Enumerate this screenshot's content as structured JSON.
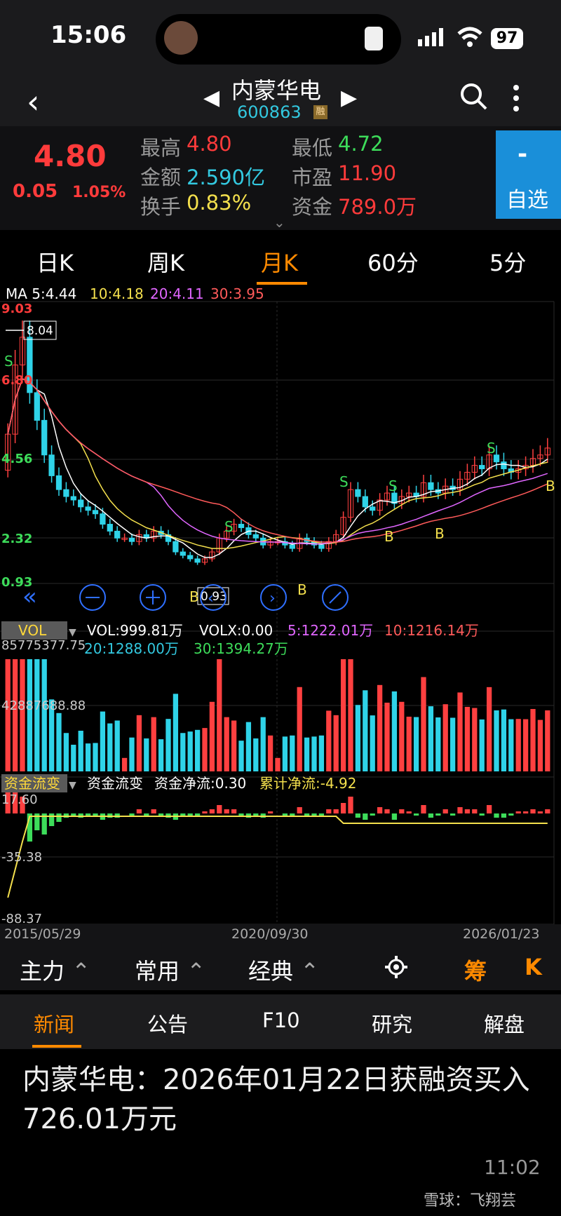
{
  "status_bar": {
    "time": "15:06",
    "battery": "97"
  },
  "nav": {
    "stock_name": "内蒙华电",
    "stock_code": "600863",
    "margin_tag": "融"
  },
  "quote": {
    "price": "4.80",
    "change": "0.05",
    "change_pct": "1.05%",
    "fields": [
      {
        "label": "最高",
        "value": "4.80",
        "color": "#ff3b3b"
      },
      {
        "label": "最低",
        "value": "4.72",
        "color": "#3ddc5a"
      },
      {
        "label": "金额",
        "value": "2.590亿",
        "color": "#33c9e0"
      },
      {
        "label": "市盈",
        "value": "11.90",
        "color": "#ff3b3b"
      },
      {
        "label": "换手",
        "value": "0.83%",
        "color": "#f4e04d"
      },
      {
        "label": "资金",
        "value": "789.0万",
        "color": "#ff3b3b"
      }
    ],
    "watch_minus": "-",
    "watch_label": "自选"
  },
  "tabs": {
    "day": "日K",
    "week": "周K",
    "month": "月K",
    "min60": "60分",
    "min5": "5分"
  },
  "ma_legend": {
    "ma5": "MA 5:4.44",
    "ma10": "10:4.18",
    "ma20": "20:4.11",
    "ma30": "30:3.95"
  },
  "price_axis": {
    "top": "9.03",
    "l2": "6.80",
    "l3": "4.56",
    "l4": "2.32",
    "bottom": "0.93"
  },
  "price_marks": {
    "high": "8.04",
    "low": "0.93",
    "sell": "S",
    "buy": "B"
  },
  "vol": {
    "tag": "VOL",
    "vol": "VOL:999.81万",
    "volx": "VOLX:0.00",
    "ma5": "5:1222.01万",
    "ma10": "10:1216.14万",
    "ma20": "20:1288.00万",
    "ma30": "30:1394.27万",
    "axis_top": "85775377.75",
    "axis_mid": "42887688.88"
  },
  "flow": {
    "tag": "资金流变",
    "name": "资金流变",
    "net": "资金净流:0.30",
    "cum": "累计净流:-4.92",
    "axis_top": "17.60",
    "axis_mid": "-35.38",
    "axis_bottom": "-88.37"
  },
  "dates": {
    "start": "2015/05/29",
    "mid": "2020/09/30",
    "end": "2026/01/23"
  },
  "toolbar": {
    "main": "主力",
    "common": "常用",
    "classic": "经典",
    "chip": "筹",
    "k": "K"
  },
  "info_tabs": {
    "news": "新闻",
    "notice": "公告",
    "f10": "F10",
    "research": "研究",
    "analysis": "解盘"
  },
  "news": {
    "title": "内蒙华电：2026年01月22日获融资买入726.01万元",
    "time": "11:02"
  },
  "watermark": "雪球：飞翔芸",
  "chart_data": {
    "type": "candlestick",
    "period": "monthly",
    "x_start": "2015/05/29",
    "x_end": "2026/01/23",
    "price_range": [
      0.93,
      9.03
    ],
    "close_approx": [
      5.2,
      7.2,
      8.0,
      6.4,
      5.6,
      4.6,
      4.0,
      3.6,
      3.4,
      3.3,
      3.1,
      3.0,
      2.9,
      2.6,
      2.4,
      2.2,
      2.2,
      2.1,
      2.3,
      2.2,
      2.4,
      2.3,
      2.1,
      1.8,
      1.7,
      1.6,
      1.5,
      1.6,
      1.8,
      2.2,
      2.4,
      2.6,
      2.5,
      2.3,
      2.2,
      2.0,
      2.1,
      2.1,
      2.0,
      1.9,
      2.2,
      2.1,
      2.0,
      1.9,
      2.1,
      2.3,
      2.8,
      3.6,
      3.4,
      3.1,
      3.0,
      3.3,
      3.5,
      3.2,
      3.4,
      3.5,
      3.4,
      3.8,
      3.6,
      3.5,
      3.7,
      3.6,
      3.9,
      4.1,
      4.3,
      4.2,
      4.6,
      4.4,
      4.2,
      4.1,
      4.2,
      4.3,
      4.5,
      4.6,
      4.8
    ],
    "colors": {
      "up": "#ff4040",
      "down": "#2fd3e8"
    }
  }
}
